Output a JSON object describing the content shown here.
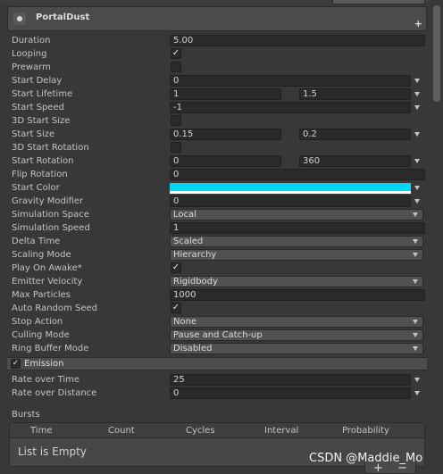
{
  "module": {
    "title": "PortalDust",
    "add_label": "+"
  },
  "main": {
    "duration": {
      "label": "Duration",
      "value": "5.00"
    },
    "looping": {
      "label": "Looping",
      "mark": "✓"
    },
    "prewarm": {
      "label": "Prewarm",
      "mark": ""
    },
    "start_delay": {
      "label": "Start Delay",
      "value": "0"
    },
    "start_lifetime": {
      "label": "Start Lifetime",
      "min": "1",
      "max": "1.5"
    },
    "start_speed": {
      "label": "Start Speed",
      "value": "-1"
    },
    "start_size_3d": {
      "label": "3D Start Size",
      "mark": ""
    },
    "start_size": {
      "label": "Start Size",
      "min": "0.15",
      "max": "0.2"
    },
    "start_rotation_3d": {
      "label": "3D Start Rotation",
      "mark": ""
    },
    "start_rotation": {
      "label": "Start Rotation",
      "min": "0",
      "max": "360"
    },
    "flip_rotation": {
      "label": "Flip Rotation",
      "value": "0"
    },
    "start_color": {
      "label": "Start Color",
      "color": "#00d8f5"
    },
    "gravity_modifier": {
      "label": "Gravity Modifier",
      "value": "0"
    },
    "simulation_space": {
      "label": "Simulation Space",
      "value": "Local"
    },
    "simulation_speed": {
      "label": "Simulation Speed",
      "value": "1"
    },
    "delta_time": {
      "label": "Delta Time",
      "value": "Scaled"
    },
    "scaling_mode": {
      "label": "Scaling Mode",
      "value": "Hierarchy"
    },
    "play_on_awake": {
      "label": "Play On Awake*",
      "mark": "✓"
    },
    "emitter_velocity": {
      "label": "Emitter Velocity",
      "value": "Rigidbody"
    },
    "max_particles": {
      "label": "Max Particles",
      "value": "1000"
    },
    "auto_random_seed": {
      "label": "Auto Random Seed",
      "mark": "✓"
    },
    "stop_action": {
      "label": "Stop Action",
      "value": "None"
    },
    "culling_mode": {
      "label": "Culling Mode",
      "value": "Pause and Catch-up"
    },
    "ring_buffer_mode": {
      "label": "Ring Buffer Mode",
      "value": "Disabled"
    }
  },
  "emission": {
    "title": "Emission",
    "mark": "✓",
    "rate_over_time": {
      "label": "Rate over Time",
      "value": "25"
    },
    "rate_over_distance": {
      "label": "Rate over Distance",
      "value": "0"
    },
    "bursts": {
      "label": "Bursts",
      "columns": [
        "Time",
        "Count",
        "Cycles",
        "Interval",
        "Probability"
      ],
      "empty_text": "List is Empty",
      "add_label": "+",
      "remove_label": "−"
    }
  },
  "watermark": "CSDN @Maddie_Mo",
  "icons": {
    "module": "particle-system-icon",
    "curve_menu": "chevron-down-icon",
    "check": "checkmark-icon"
  }
}
